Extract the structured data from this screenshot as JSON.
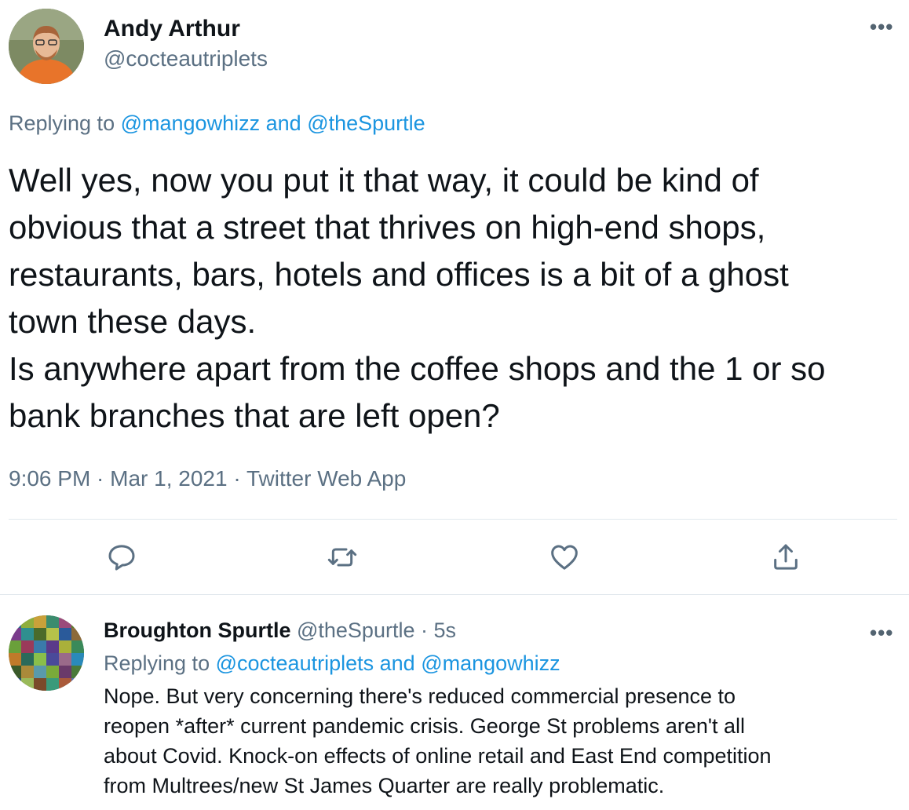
{
  "main_tweet": {
    "display_name": "Andy Arthur",
    "handle": "@cocteautriplets",
    "replying_prefix": "Replying to",
    "reply_to_1": "@mangowhizz",
    "reply_joiner": "and",
    "reply_to_2": "@theSpurtle",
    "body_lines": [
      "Well yes, now you put it that way, it could be kind of",
      "obvious that a street that thrives on high-end shops,",
      "restaurants, bars, hotels and offices is a bit of a ghost",
      "town these days.",
      "Is anywhere apart from the coffee shops and the 1 or so",
      "bank branches that are left open?"
    ],
    "meta": "9:06 PM · Mar 1, 2021 · Twitter Web App",
    "more_icon": "ellipsis-icon"
  },
  "actions": [
    {
      "icon": "reply-icon"
    },
    {
      "icon": "retweet-icon"
    },
    {
      "icon": "like-icon"
    },
    {
      "icon": "share-icon"
    }
  ],
  "reply_tweet": {
    "display_name": "Broughton Spurtle",
    "handle": "@theSpurtle",
    "separator": "·",
    "time": "5s",
    "replying_prefix": "Replying to",
    "reply_to_1": "@cocteautriplets",
    "reply_joiner": "and",
    "reply_to_2": "@mangowhizz",
    "body_lines": [
      "Nope. But very concerning there's reduced commercial presence to",
      "reopen *after* current pandemic crisis. George St problems aren't all",
      "about Covid. Knock-on effects of online retail and East End competition",
      "from Multrees/new St James Quarter are really problematic."
    ]
  },
  "colors": {
    "link": "#1b95e0",
    "secondary": "#5b7083",
    "divider": "#e1e8ed"
  }
}
